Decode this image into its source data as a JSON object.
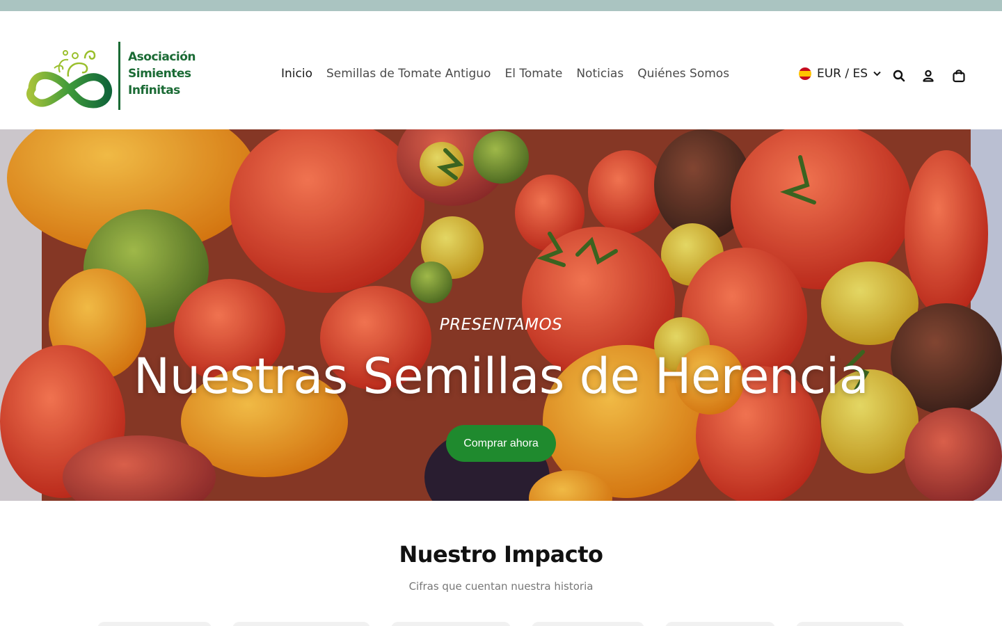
{
  "header": {
    "logo": {
      "line1": "Asociación",
      "line2": "Simientes",
      "line3": "Infinitas",
      "icon": "infinity-vine-logo"
    },
    "nav": [
      {
        "label": "Inicio",
        "active": true
      },
      {
        "label": "Semillas de Tomate Antiguo",
        "active": false
      },
      {
        "label": "El Tomate",
        "active": false
      },
      {
        "label": "Noticias",
        "active": false
      },
      {
        "label": "Quiénes Somos",
        "active": false
      }
    ],
    "locale": {
      "label": "EUR / ES",
      "flag": "spain-flag-icon"
    },
    "icons": [
      "search-icon",
      "account-icon",
      "cart-icon"
    ]
  },
  "hero": {
    "eyebrow": "PRESENTAMOS",
    "title": "Nuestras Semillas de Herencia",
    "cta": "Comprar ahora"
  },
  "impact": {
    "title": "Nuestro Impacto",
    "subtitle": "Cifras que cuentan nuestra historia"
  },
  "colors": {
    "topbar": "#aac4c1",
    "brand_green": "#1b6b35",
    "cta_green": "#1f8a2e"
  }
}
